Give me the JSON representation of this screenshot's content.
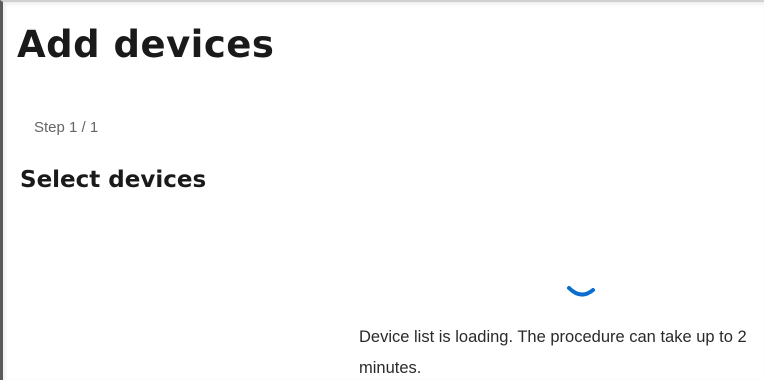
{
  "page": {
    "title": "Add devices",
    "step": "Step 1 / 1",
    "subtitle": "Select devices"
  },
  "loading": {
    "message": "Device list is loading. The procedure can take up to 2 minutes.",
    "spinner_icon": "loading-spinner-icon",
    "spinner_color": "#0a6ecf"
  }
}
